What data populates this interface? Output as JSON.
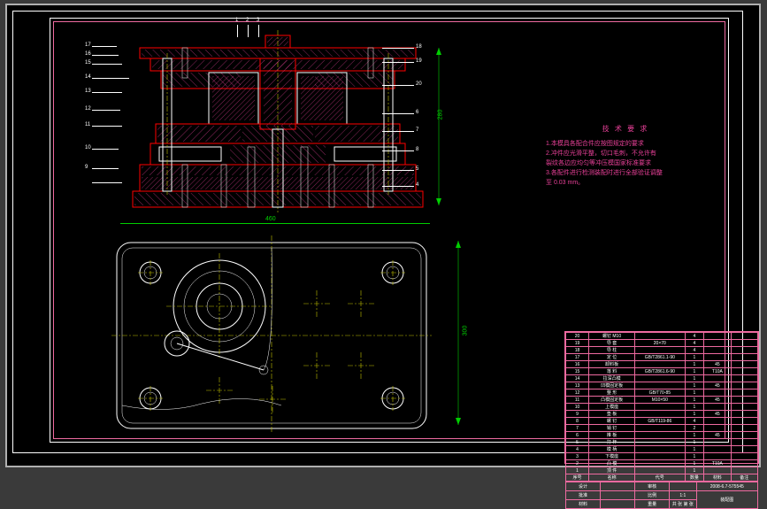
{
  "drawing": {
    "dim_width": "460",
    "dim_height_section": "280",
    "dim_height_plan": "300",
    "balloons_top": [
      "1",
      "2",
      "3"
    ],
    "balloons_left": [
      "17",
      "16",
      "15",
      "14",
      "13",
      "12",
      "11",
      "10",
      "9"
    ],
    "balloons_right": [
      "18",
      "19",
      "20",
      "6",
      "7",
      "8",
      "5",
      "4"
    ]
  },
  "notes": {
    "title": "技 术 要 求",
    "line1": "1.本模具各配合件应按图规定的要求",
    "line2": "2.冲件应光滑平整，切口毛刺，不允许有",
    "line3": "  裂纹各边应均匀等冲压模国家标准要求",
    "line4": "3.各配件进行检测装配时进行全部验证调整",
    "line5": "  至 0.03 mm。"
  },
  "titleblock": {
    "drawing_no_label": "2008-6.7-575545",
    "scale_label": "比例",
    "scale_value": "1:1",
    "sheet": "共 张  第 张",
    "title": "装配图",
    "design": "设计",
    "check": "审核",
    "appr": "批准",
    "mat": "材料",
    "wt": "重量"
  },
  "bom": {
    "headers": [
      "序号",
      "名称",
      "代号",
      "数量",
      "材料",
      "备注"
    ],
    "rows": [
      {
        "n": "20",
        "name": "螺钉 M10",
        "code": "",
        "qty": "4",
        "mat": "",
        "rem": ""
      },
      {
        "n": "19",
        "name": "导 套",
        "code": "20×70",
        "qty": "4",
        "mat": "",
        "rem": ""
      },
      {
        "n": "18",
        "name": "导 柱",
        "code": "",
        "qty": "4",
        "mat": "",
        "rem": ""
      },
      {
        "n": "17",
        "name": "定 位",
        "code": "GB/T2861.1-90",
        "qty": "1",
        "mat": "",
        "rem": ""
      },
      {
        "n": "16",
        "name": "卸料板",
        "code": "",
        "qty": "1",
        "mat": "45",
        "rem": ""
      },
      {
        "n": "15",
        "name": "落 料",
        "code": "GB/T2861.6-90",
        "qty": "1",
        "mat": "T10A",
        "rem": ""
      },
      {
        "n": "14",
        "name": "拉深凸模",
        "code": "",
        "qty": "1",
        "mat": "",
        "rem": ""
      },
      {
        "n": "13",
        "name": "凹模固定板",
        "code": "",
        "qty": "1",
        "mat": "45",
        "rem": ""
      },
      {
        "n": "12",
        "name": "整 形",
        "code": "GB/T70-85",
        "qty": "1",
        "mat": "",
        "rem": ""
      },
      {
        "n": "11",
        "name": "凸模固定板",
        "code": "M10×50",
        "qty": "1",
        "mat": "45",
        "rem": ""
      },
      {
        "n": "10",
        "name": "上模座",
        "code": "",
        "qty": "1",
        "mat": "",
        "rem": ""
      },
      {
        "n": "9",
        "name": "垫 板",
        "code": "",
        "qty": "1",
        "mat": "45",
        "rem": ""
      },
      {
        "n": "8",
        "name": "螺 钉",
        "code": "GB/T119-86",
        "qty": "4",
        "mat": "",
        "rem": ""
      },
      {
        "n": "7",
        "name": "销 钉",
        "code": "",
        "qty": "2",
        "mat": "",
        "rem": ""
      },
      {
        "n": "6",
        "name": "推 板",
        "code": "",
        "qty": "1",
        "mat": "45",
        "rem": ""
      },
      {
        "n": "5",
        "name": "打 杆",
        "code": "",
        "qty": "1",
        "mat": "",
        "rem": ""
      },
      {
        "n": "4",
        "name": "模 柄",
        "code": "",
        "qty": "1",
        "mat": "",
        "rem": ""
      },
      {
        "n": "3",
        "name": "下模座",
        "code": "",
        "qty": "1",
        "mat": "",
        "rem": ""
      },
      {
        "n": "2",
        "name": "凸 模",
        "code": "",
        "qty": "1",
        "mat": "T10A",
        "rem": ""
      },
      {
        "n": "1",
        "name": "顶 件",
        "code": "",
        "qty": "1",
        "mat": "",
        "rem": ""
      }
    ]
  }
}
